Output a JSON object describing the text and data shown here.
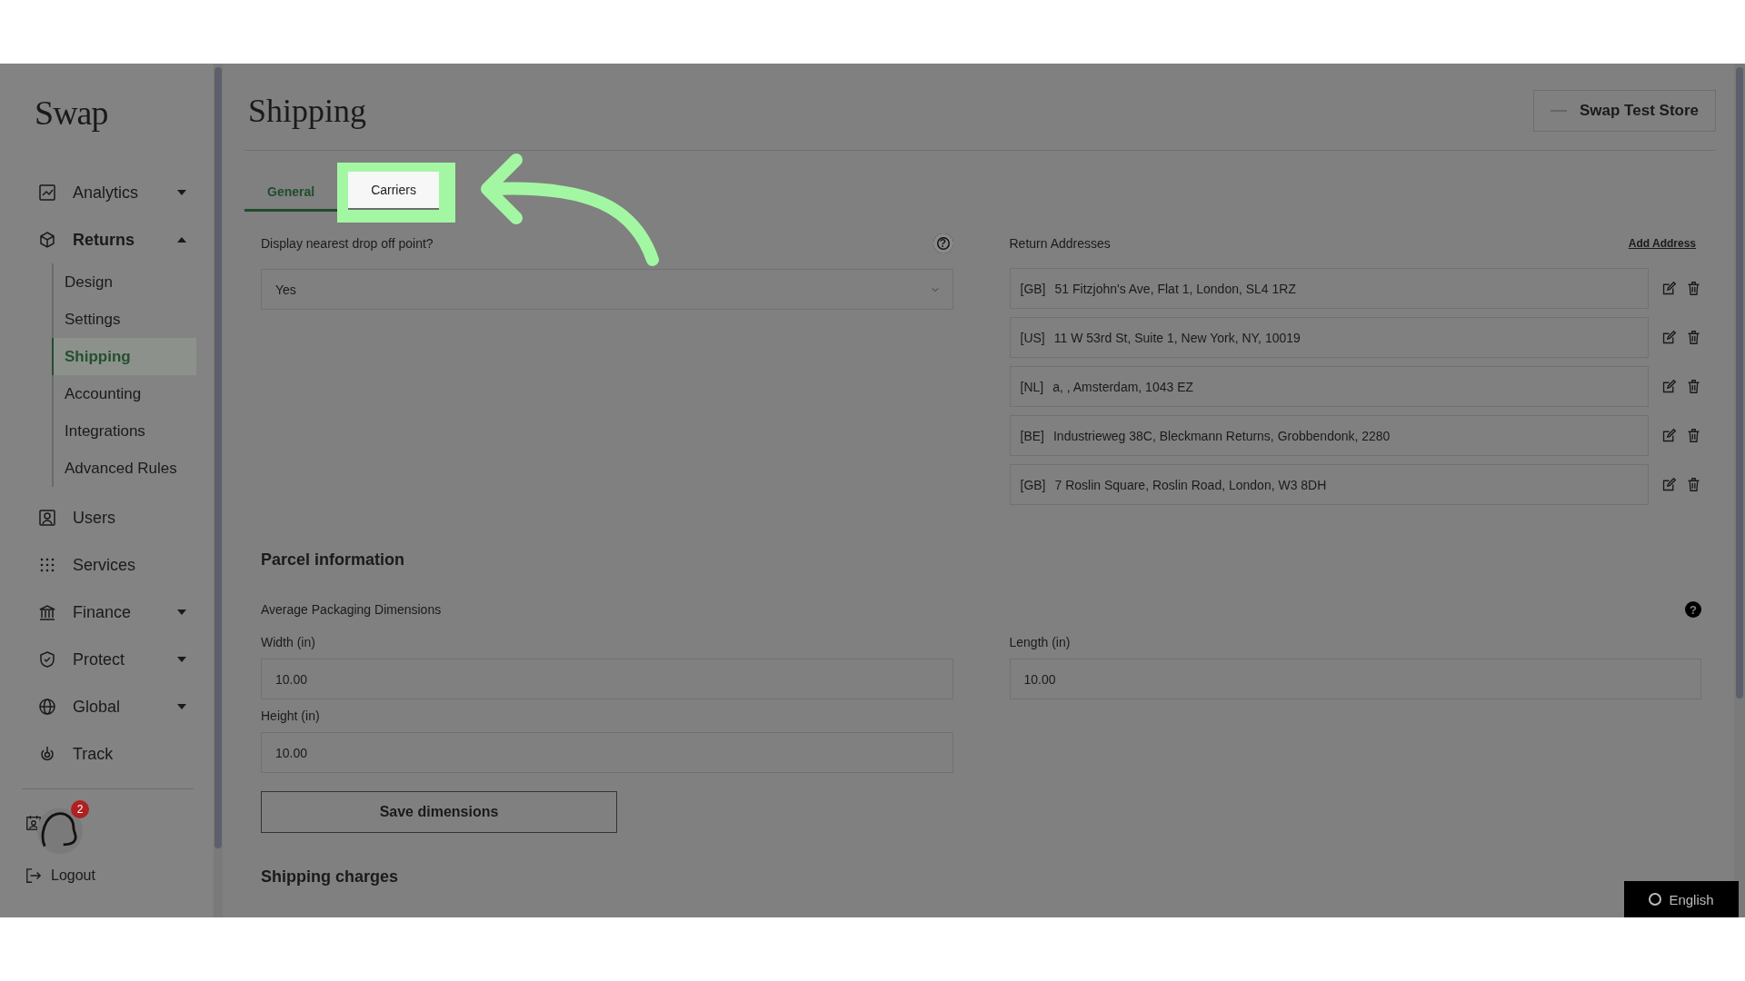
{
  "sidebar": {
    "logo": "Swap",
    "items": [
      {
        "label": "Analytics",
        "kind": "group",
        "expanded": false
      },
      {
        "label": "Returns",
        "kind": "group",
        "expanded": true,
        "children": [
          {
            "label": "Design",
            "selected": false
          },
          {
            "label": "Settings",
            "selected": false
          },
          {
            "label": "Shipping",
            "selected": true
          },
          {
            "label": "Accounting",
            "selected": false
          },
          {
            "label": "Integrations",
            "selected": false
          },
          {
            "label": "Advanced Rules",
            "selected": false
          }
        ]
      },
      {
        "label": "Users",
        "kind": "link"
      },
      {
        "label": "Services",
        "kind": "link"
      },
      {
        "label": "Finance",
        "kind": "group",
        "expanded": false
      },
      {
        "label": "Protect",
        "kind": "group",
        "expanded": false
      },
      {
        "label": "Global",
        "kind": "group",
        "expanded": false
      },
      {
        "label": "Track",
        "kind": "link"
      }
    ],
    "logout": "Logout",
    "notification_count": "2"
  },
  "header": {
    "title": "Shipping",
    "store": "Swap Test Store"
  },
  "tabs": [
    {
      "label": "General",
      "selected": true,
      "highlighted": false
    },
    {
      "label": "Carriers",
      "selected": false,
      "highlighted": true
    }
  ],
  "drop_off": {
    "label": "Display nearest drop off point?",
    "help": "?",
    "value": "Yes"
  },
  "return_addresses": {
    "title": "Return Addresses",
    "add": "Add Address",
    "rows": [
      {
        "country": "[GB]",
        "address": "51 Fitzjohn's Ave, Flat 1, London, SL4 1RZ"
      },
      {
        "country": "[US]",
        "address": "11 W 53rd St, Suite 1, New York, NY, 10019"
      },
      {
        "country": "[NL]",
        "address": "a, , Amsterdam, 1043 EZ"
      },
      {
        "country": "[BE]",
        "address": "Industrieweg 38C, Bleckmann Returns, Grobbendonk, 2280"
      },
      {
        "country": "[GB]",
        "address": "7 Roslin Square, Roslin Road, London, W3 8DH"
      }
    ]
  },
  "parcel": {
    "title": "Parcel information",
    "subtitle": "Average Packaging Dimensions",
    "help": "?",
    "fields": [
      {
        "label": "Width (in)",
        "value": "10.00"
      },
      {
        "label": "Length (in)",
        "value": "10.00"
      },
      {
        "label": "Height (in)",
        "value": "10.00"
      }
    ],
    "save": "Save dimensions"
  },
  "shipping_charges": {
    "title": "Shipping charges"
  },
  "language": "English"
}
